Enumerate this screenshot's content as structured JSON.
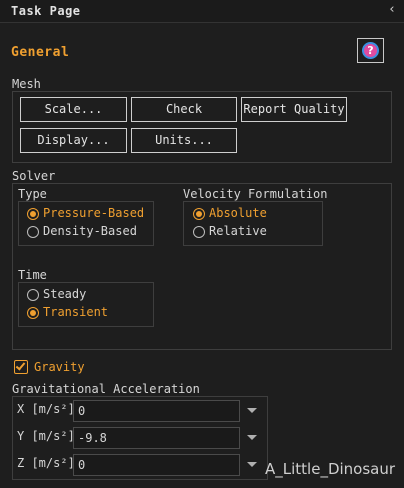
{
  "panel": {
    "title": "Task Page",
    "collapse_glyph": "‹",
    "section": "General",
    "help_glyph": "?"
  },
  "mesh": {
    "label": "Mesh",
    "buttons": [
      "Scale...",
      "Check",
      "Report Quality",
      "Display...",
      "Units..."
    ]
  },
  "solver": {
    "label": "Solver",
    "type": {
      "label": "Type",
      "options": [
        "Pressure-Based",
        "Density-Based"
      ],
      "selected": "Pressure-Based"
    },
    "velocity": {
      "label": "Velocity Formulation",
      "options": [
        "Absolute",
        "Relative"
      ],
      "selected": "Absolute"
    },
    "time": {
      "label": "Time",
      "options": [
        "Steady",
        "Transient"
      ],
      "selected": "Transient"
    }
  },
  "gravity": {
    "label": "Gravity",
    "checked": true
  },
  "grav_accel": {
    "label": "Gravitational Acceleration",
    "rows": [
      {
        "label": "X [m/s²]",
        "value": "0"
      },
      {
        "label": "Y [m/s²]",
        "value": "-9.8"
      },
      {
        "label": "Z [m/s²]",
        "value": "0"
      }
    ]
  },
  "watermark": "A_Little_Dinosaur",
  "colors": {
    "accent": "#f0a030",
    "background": "#1e1e1e",
    "help_icon": "#e04ba0",
    "help_ring": "#3b8fe0"
  },
  "icons": {
    "collapse": "chevron-left-icon",
    "help": "help-icon",
    "dropdown": "chevron-down-icon",
    "check": "checkmark-icon"
  }
}
